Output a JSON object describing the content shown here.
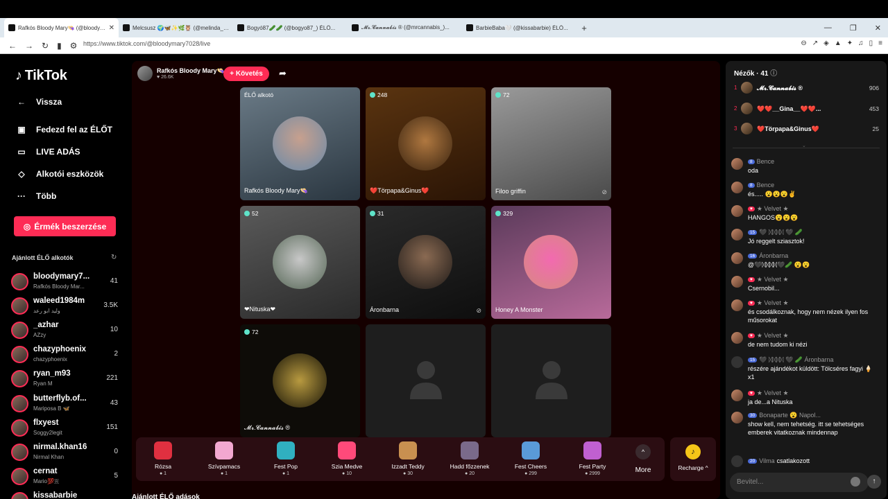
{
  "tabs": [
    {
      "title": "Rafkós Bloody Mary👒 (@bloodymary7028) ÉLŐ..."
    },
    {
      "title": "Melcsusz 🌍🦋✨🌿🦉 (@melinda_)..."
    },
    {
      "title": "Bogyó87🥒🥒 (@bogyo87_) ÉLŐ..."
    },
    {
      "title": "𝓜𝓻.𝓒𝓪𝓷𝓷𝓪𝓫𝓲𝓼 ® (@mrcannabis_)..."
    },
    {
      "title": "BarbieBaba🤍 (@kissabarbie) ÉLŐ..."
    }
  ],
  "address": {
    "url": "https://www.tiktok.com/@bloodymary7028/live"
  },
  "brand": {
    "name": "TikTok",
    "accent": "#fe2c55"
  },
  "nav": {
    "back": "Vissza",
    "explore": "Fedezd fel az ÉLŐT",
    "live": "LIVE ADÁS",
    "tools": "Alkotói eszközök",
    "more": "Több",
    "coins": "Érmék beszerzése"
  },
  "recommended": {
    "title": "Ajánlott ÉLŐ alkotók",
    "items": [
      {
        "name": "bloodymary7...",
        "sub": "Rafkós Bloody Mar...",
        "count": "41"
      },
      {
        "name": "waleed1984m",
        "sub": "وليد ابو رعد",
        "count": "3.5K"
      },
      {
        "name": "_azhar",
        "sub": "AZzy",
        "count": "10"
      },
      {
        "name": "chazyphoenix",
        "sub": "chazyphoenix",
        "count": "2"
      },
      {
        "name": "ryan_m93",
        "sub": "Ryan M",
        "count": "221"
      },
      {
        "name": "butterflyb.of...",
        "sub": "Mariposa B 🦋",
        "count": "43"
      },
      {
        "name": "flxyest",
        "sub": "Soggy2legit",
        "count": "151"
      },
      {
        "name": "nirmal.khan16",
        "sub": "Nirmal Khan",
        "count": "0"
      },
      {
        "name": "cernat",
        "sub": "Mario💯🇷",
        "count": "5"
      },
      {
        "name": "kissabarbie",
        "sub": "",
        "count": ""
      }
    ]
  },
  "host": {
    "name": "Rafkós Bloody Mary👒",
    "likes": "26.6K",
    "follow": "+ Követés"
  },
  "tiles": [
    {
      "count": "ÉLŐ alkotó",
      "label": "Rafkós Bloody Mary👒"
    },
    {
      "count": "248",
      "label": "❤️Törpapa&Ginus❤️"
    },
    {
      "count": "72",
      "label": "Filoo griffin"
    },
    {
      "count": "52",
      "label": "❤Nituska❤"
    },
    {
      "count": "31",
      "label": "Áronbarna"
    },
    {
      "count": "329",
      "label": "Honey A Monster"
    },
    {
      "count": "72",
      "label": "𝓜𝓻.𝓒𝓪𝓷𝓷𝓪𝓫𝓲𝓼 ®"
    }
  ],
  "gifts": [
    {
      "name": "Rózsa",
      "price": "1"
    },
    {
      "name": "Szívpamacs",
      "price": "1"
    },
    {
      "name": "Fest Pop",
      "price": "1"
    },
    {
      "name": "Szia Medve",
      "price": "10"
    },
    {
      "name": "Izzadt Teddy",
      "price": "30"
    },
    {
      "name": "Hadd főzzenek",
      "price": "20"
    },
    {
      "name": "Fest Cheers",
      "price": "299"
    },
    {
      "name": "Fest Party",
      "price": "2999"
    }
  ],
  "gift_more": "More",
  "recharge": "Recharge ^",
  "rec_lives": "Ajánlott ÉLŐ adások",
  "chat": {
    "viewers_title": "Nézők · 41",
    "top": [
      {
        "rank": "1",
        "name": "𝓜𝓻.𝓒𝓪𝓷𝓷𝓪𝓫𝓲𝓼 ®",
        "score": "906"
      },
      {
        "rank": "2",
        "name": "❤️❤️__Gina__❤️❤️...",
        "score": "453"
      },
      {
        "rank": "3",
        "name": "❤️Törpapa&Ginus❤️",
        "score": "25"
      }
    ],
    "messages": [
      {
        "badge": "8",
        "user": "Bence",
        "text": "oda"
      },
      {
        "badge": "8",
        "user": "Bence",
        "text": "és..... 😮😮😮✌"
      },
      {
        "badge": "",
        "user": "★ Velvet ★",
        "text": "HANGOS😮😮😮"
      },
      {
        "badge": "15",
        "user": "🖤 ᛞᛞᛞᛞ 🖤 🥒",
        "text": "Jó reggelt sziasztok!"
      },
      {
        "badge": "16",
        "user": "Áronbarna",
        "text": "@🖤ᛞᛞᛞᛞ🖤🥒 😮😮"
      },
      {
        "badge": "",
        "user": "★ Velvet ★",
        "text": "Csernobil..."
      },
      {
        "badge": "",
        "user": "★ Velvet ★",
        "text": "és csodálkoznak, hogy nem nézek ilyen fos műsorokat"
      },
      {
        "badge": "",
        "user": "★ Velvet ★",
        "text": "de nem tudom ki nézi"
      },
      {
        "badge": "15",
        "user": "🖤 ᛞᛞᛞᛞ 🖤 🥒 Áronbarna",
        "text": "részére ajándékot küldött: Tölcséres fagyi 🍦 x1"
      },
      {
        "badge": "",
        "user": "★ Velvet ★",
        "text": "ja de...a Nituska"
      },
      {
        "badge": "30",
        "user": "Bonaparte 😮 Napol...",
        "text": "show kell, nem tehetség. itt se tehetséges emberek vitatkoznak mindennap"
      },
      {
        "badge": "20",
        "user": "Vilma",
        "text": "csatlakozott"
      }
    ],
    "input_placeholder": "Bevitel..."
  }
}
